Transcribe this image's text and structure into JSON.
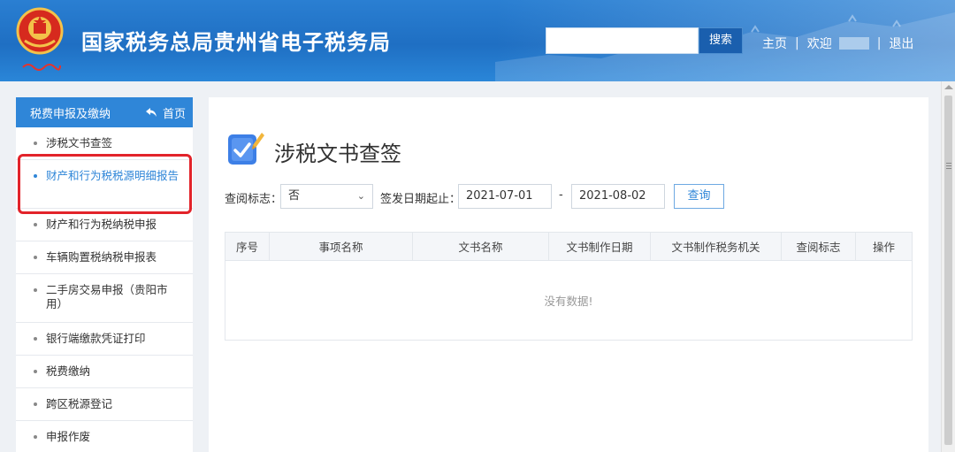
{
  "header": {
    "title": "国家税务总局贵州省电子税务局",
    "search_placeholder": "",
    "search_button": "搜索",
    "nav": {
      "home": "主页",
      "sep": "|",
      "welcome": "欢迎",
      "logout": "退出"
    }
  },
  "sidebar": {
    "heading": "税费申报及缴纳",
    "home_link": "首页",
    "items": [
      {
        "label": "涉税文书查签"
      },
      {
        "label": "财产和行为税税源明细报告"
      },
      {
        "label": "财产和行为税纳税申报"
      },
      {
        "label": "车辆购置税纳税申报表"
      },
      {
        "label": "二手房交易申报（贵阳市用）"
      },
      {
        "label": "银行端缴款凭证打印"
      },
      {
        "label": "税费缴纳"
      },
      {
        "label": "跨区税源登记"
      },
      {
        "label": "申报作废"
      }
    ],
    "active_index": 1
  },
  "main": {
    "title": "涉税文书查签",
    "filters": {
      "read_flag_label": "查阅标志：",
      "read_flag_value": "否",
      "date_range_label": "签发日期起止：",
      "date_from": "2021-07-01",
      "date_sep": "-",
      "date_to": "2021-08-02",
      "query_button": "查询"
    },
    "table": {
      "columns": [
        "序号",
        "事项名称",
        "文书名称",
        "文书制作日期",
        "文书制作税务机关",
        "查阅标志",
        "操作"
      ],
      "empty_message": "没有数据!"
    }
  },
  "colors": {
    "header_blue": "#1f6fc3",
    "accent": "#2f86d8",
    "highlight_red": "#e2232a"
  },
  "icons": {
    "emblem": "national-tax-emblem",
    "home": "back-arrow-icon",
    "page": "document-check-icon",
    "select": "chevron-down-icon"
  }
}
